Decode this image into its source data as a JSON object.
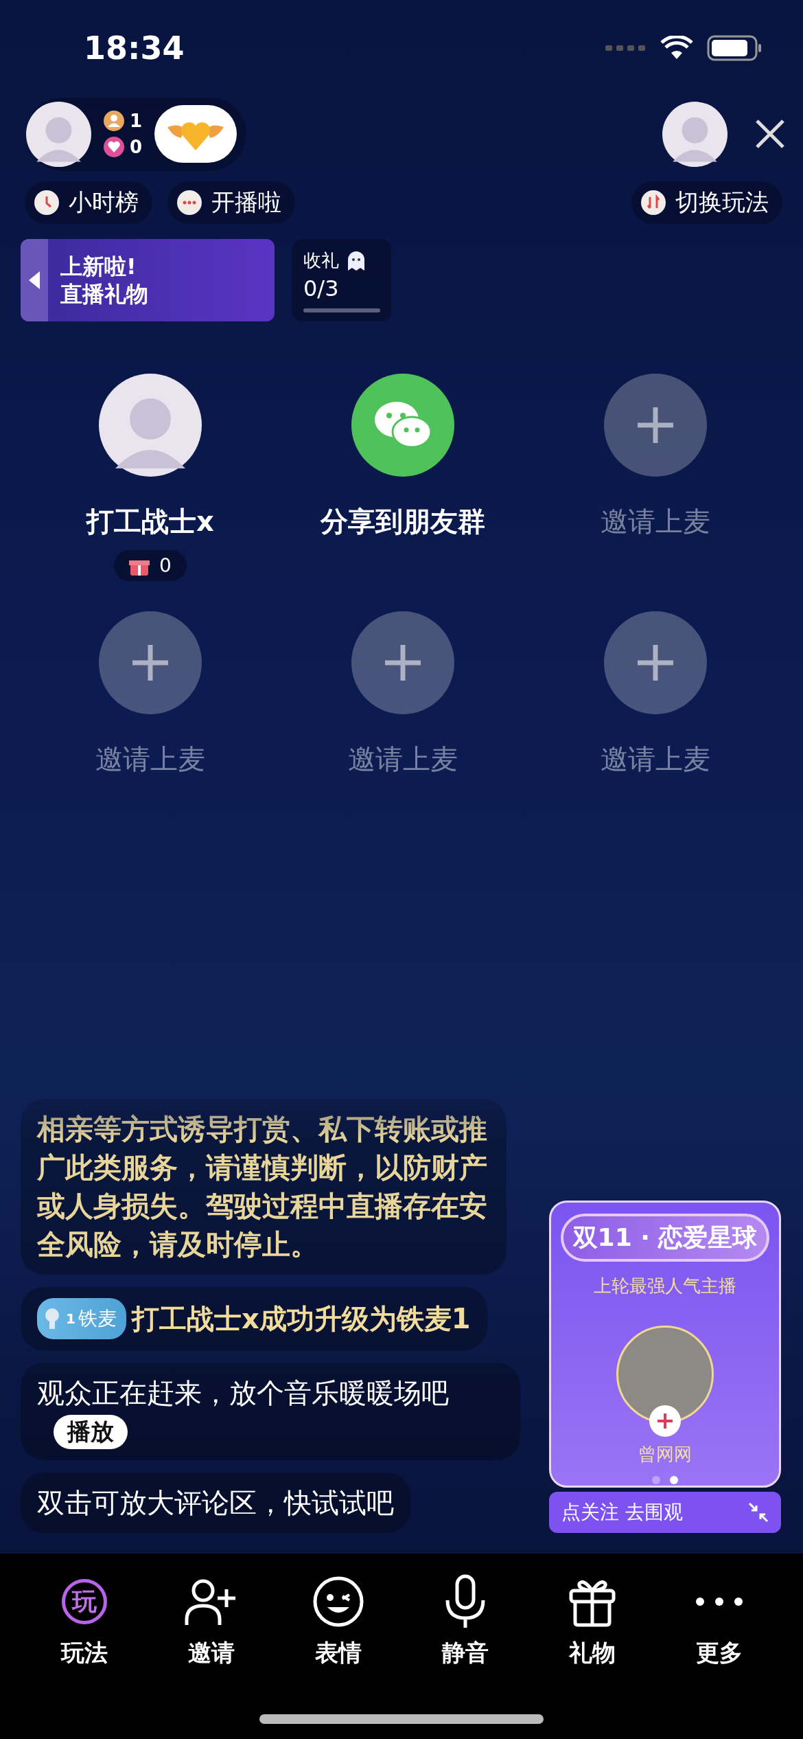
{
  "status_bar": {
    "time": "18:34"
  },
  "host": {
    "stats": [
      {
        "kind": "person",
        "value": "1"
      },
      {
        "kind": "heart",
        "value": "0"
      }
    ]
  },
  "chips": [
    {
      "kind": "clock",
      "label": "小时榜"
    },
    {
      "kind": "chat",
      "label": "开播啦"
    },
    {
      "kind": "switch",
      "label": "切换玩法"
    }
  ],
  "banner": {
    "lines": [
      "上新啦!",
      "直播礼物"
    ]
  },
  "gift_task": {
    "label": "收礼",
    "count": "0/3",
    "level": 0
  },
  "seats": [
    {
      "kind": "user",
      "name": "打工战士x",
      "gifts": "0"
    },
    {
      "kind": "share",
      "name": "分享到朋友群"
    },
    {
      "kind": "empty",
      "name": "邀请上麦"
    },
    {
      "kind": "empty",
      "name": "邀请上麦"
    },
    {
      "kind": "empty",
      "name": "邀请上麦"
    },
    {
      "kind": "empty",
      "name": "邀请上麦"
    }
  ],
  "messages": [
    {
      "kind": "notice",
      "text": "相亲等方式诱导打赏、私下转账或推广此类服务，请谨慎判断，以防财产或人身损失。驾驶过程中直播存在安全风险，请及时停止。"
    },
    {
      "kind": "upgrade",
      "badge_level": "1",
      "badge": "铁麦",
      "text": "打工战士x成功升级为铁麦1"
    },
    {
      "kind": "action",
      "text": "观众正在赶来，放个音乐暖暖场吧",
      "button": "播放"
    },
    {
      "kind": "plain",
      "text": "双击可放大评论区，快试试吧"
    }
  ],
  "promo": {
    "title": "双11 · 恋爱星球",
    "subtitle": "上轮最强人气主播",
    "name": "曾网网",
    "pages": [
      {
        "selected": false
      },
      {
        "selected": true
      }
    ],
    "follow": "点关注 去围观"
  },
  "nav": [
    {
      "kind": "play",
      "glyph": "玩",
      "label": "玩法"
    },
    {
      "kind": "invite",
      "label": "邀请"
    },
    {
      "kind": "emoji",
      "label": "表情"
    },
    {
      "kind": "mic",
      "label": "静音"
    },
    {
      "kind": "gift",
      "label": "礼物"
    },
    {
      "kind": "more",
      "label": "更多"
    }
  ]
}
